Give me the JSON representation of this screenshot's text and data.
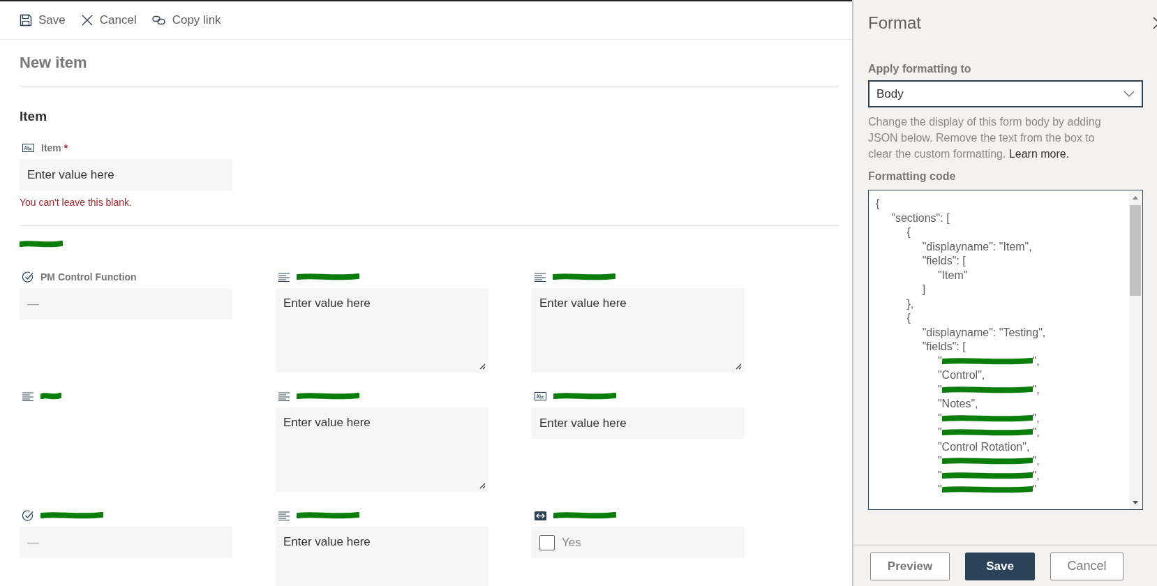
{
  "toolbar": [
    {
      "label": "Save"
    },
    {
      "label": "Cancel"
    },
    {
      "label": "Copy link"
    }
  ],
  "form_title": "New item",
  "sections": [
    {
      "title": "Item",
      "redacted": false,
      "fields": [
        {
          "label": "Item",
          "redacted": false,
          "required_mark": "*",
          "kind": "text",
          "placeholder": "Enter value here",
          "error": "You can't leave this blank."
        }
      ]
    },
    {
      "redacted": true,
      "fields": [
        {
          "label": "PM Control Function",
          "redacted": false,
          "kind": "choice",
          "value": "—"
        },
        {
          "redacted": true,
          "kind": "multiline",
          "placeholder": "Enter value here"
        },
        {
          "redacted": true,
          "kind": "multiline",
          "placeholder": "Enter value here"
        },
        {
          "redacted": true,
          "kind": "multiline_blank"
        },
        {
          "redacted": true,
          "kind": "multiline",
          "placeholder": "Enter value here"
        },
        {
          "redacted": true,
          "kind": "text",
          "placeholder": "Enter value here"
        },
        {
          "redacted": true,
          "kind": "choice",
          "value": "—"
        },
        {
          "redacted": true,
          "kind": "multiline",
          "placeholder": "Enter value here"
        },
        {
          "redacted": true,
          "kind": "boolean",
          "checked": false,
          "value": "Yes"
        }
      ]
    }
  ],
  "format_panel": {
    "title": "Format",
    "apply_label": "Apply formatting to",
    "apply_value": "Body",
    "description": "Change the display of this form body by adding JSON below. Remove the text from the box to clear the custom formatting.",
    "learn_more": "Learn more.",
    "code_label": "Formatting code",
    "code_lines": [
      {
        "text": "{"
      },
      {
        "text": "     \"sections\": ["
      },
      {
        "text": "          {"
      },
      {
        "text": "               \"displayname\": \"Item\","
      },
      {
        "text": "               \"fields\": ["
      },
      {
        "text": "                    \"Item\""
      },
      {
        "text": "               ]"
      },
      {
        "text": "          },"
      },
      {
        "text": "          {"
      },
      {
        "text": "               \"displayname\": \"Testing\","
      },
      {
        "text": "               \"fields\": ["
      },
      {
        "text": "                    \"",
        "after": "\",",
        "redacted": true
      },
      {
        "text": "                    \"Control\","
      },
      {
        "text": "                    \"",
        "after": "\",",
        "redacted": true
      },
      {
        "text": "                    \"Notes\","
      },
      {
        "text": "                    \"",
        "after": "\",",
        "redacted": true
      },
      {
        "text": "                    \"",
        "after": "\",",
        "redacted": true
      },
      {
        "text": "                    \"Control Rotation\","
      },
      {
        "text": "                    \"",
        "after": "\",",
        "redacted": true
      },
      {
        "text": "                    \"",
        "after": "\",",
        "redacted": true
      },
      {
        "text": "                    \"",
        "after": "\"",
        "redacted": true
      }
    ],
    "buttons": [
      {
        "label": "Preview",
        "primary": false
      },
      {
        "label": "Save",
        "primary": true
      },
      {
        "label": "Cancel",
        "primary": false
      }
    ]
  }
}
